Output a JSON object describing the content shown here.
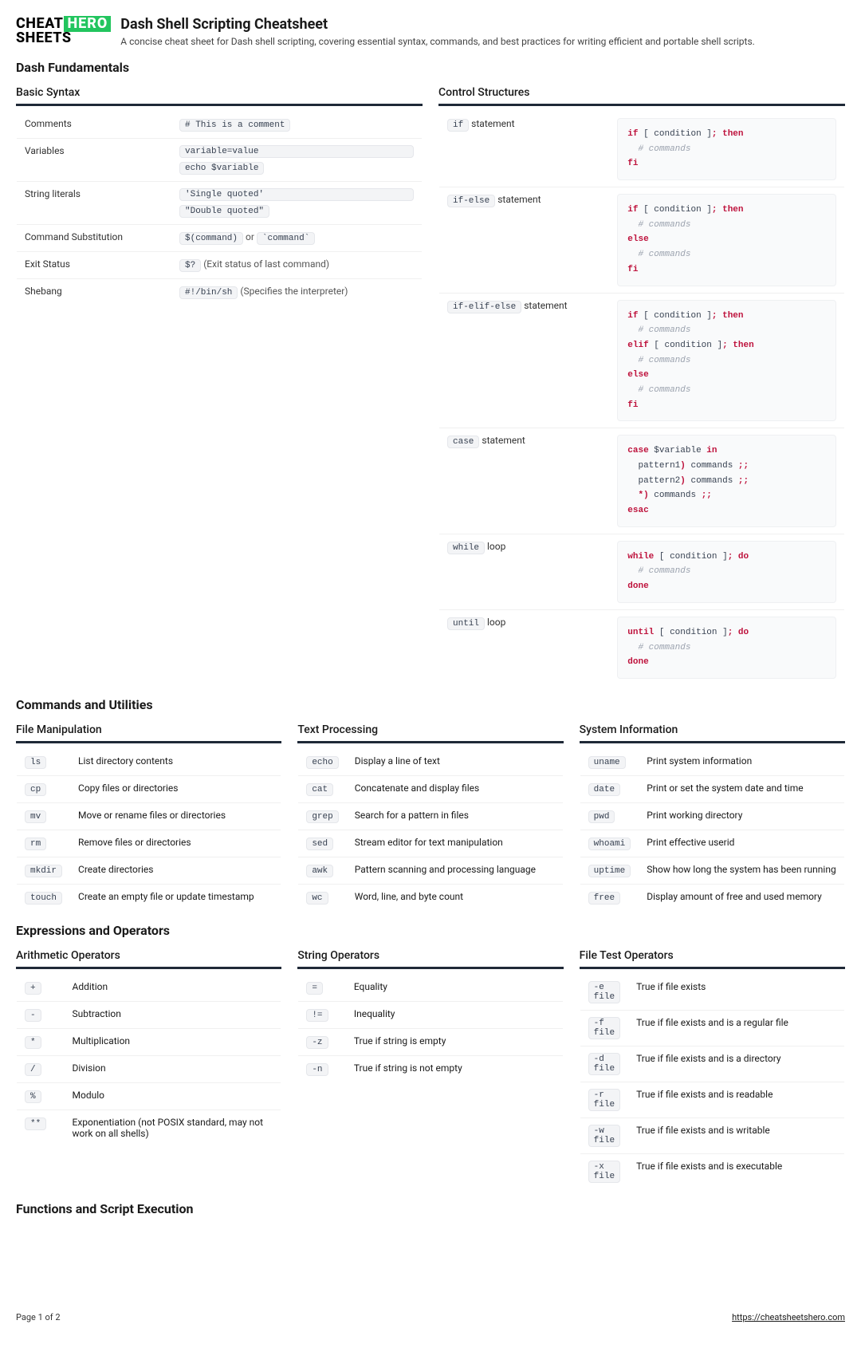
{
  "header": {
    "logo_top_left": "CHEAT",
    "logo_top_right": "HERO",
    "logo_bottom": "SHEETS",
    "title": "Dash Shell Scripting Cheatsheet",
    "subtitle": "A concise cheat sheet for Dash shell scripting, covering essential syntax, commands, and best practices for writing efficient and portable shell scripts."
  },
  "sections": {
    "fundamentals": {
      "title": "Dash Fundamentals",
      "basic_syntax": {
        "title": "Basic Syntax",
        "rows": [
          {
            "label": "Comments",
            "code": "# This is a comment"
          },
          {
            "label": "Variables",
            "code1": "variable=value",
            "code2": "echo $variable"
          },
          {
            "label": "String literals",
            "code1": "'Single quoted'",
            "code2": "\"Double quoted\""
          },
          {
            "label": "Command Substitution",
            "code": "$(command)",
            "note": " or ",
            "code2b": "`command`"
          },
          {
            "label": "Exit Status",
            "code": "$?",
            "note": " (Exit status of last command)"
          },
          {
            "label": "Shebang",
            "code": "#!/bin/sh",
            "note": " (Specifies the interpreter)"
          }
        ]
      },
      "control": {
        "title": "Control Structures",
        "rows": [
          {
            "label_code": "if",
            "label_text": " statement"
          },
          {
            "label_code": "if-else",
            "label_text": " statement"
          },
          {
            "label_code": "if-elif-else",
            "label_text": " statement"
          },
          {
            "label_code": "case",
            "label_text": " statement"
          },
          {
            "label_code": "while",
            "label_text": " loop"
          },
          {
            "label_code": "until",
            "label_text": " loop"
          }
        ]
      }
    },
    "commands": {
      "title": "Commands and Utilities",
      "file": {
        "title": "File Manipulation",
        "rows": [
          {
            "cmd": "ls",
            "desc": "List directory contents"
          },
          {
            "cmd": "cp",
            "desc": "Copy files or directories"
          },
          {
            "cmd": "mv",
            "desc": "Move or rename files or directories"
          },
          {
            "cmd": "rm",
            "desc": "Remove files or directories"
          },
          {
            "cmd": "mkdir",
            "desc": "Create directories"
          },
          {
            "cmd": "touch",
            "desc": "Create an empty file or update timestamp"
          }
        ]
      },
      "text": {
        "title": "Text Processing",
        "rows": [
          {
            "cmd": "echo",
            "desc": "Display a line of text"
          },
          {
            "cmd": "cat",
            "desc": "Concatenate and display files"
          },
          {
            "cmd": "grep",
            "desc": "Search for a pattern in files"
          },
          {
            "cmd": "sed",
            "desc": "Stream editor for text manipulation"
          },
          {
            "cmd": "awk",
            "desc": "Pattern scanning and processing language"
          },
          {
            "cmd": "wc",
            "desc": "Word, line, and byte count"
          }
        ]
      },
      "system": {
        "title": "System Information",
        "rows": [
          {
            "cmd": "uname",
            "desc": "Print system information"
          },
          {
            "cmd": "date",
            "desc": "Print or set the system date and time"
          },
          {
            "cmd": "pwd",
            "desc": "Print working directory"
          },
          {
            "cmd": "whoami",
            "desc": "Print effective userid"
          },
          {
            "cmd": "uptime",
            "desc": "Show how long the system has been running"
          },
          {
            "cmd": "free",
            "desc": "Display amount of free and used memory"
          }
        ]
      }
    },
    "expressions": {
      "title": "Expressions and Operators",
      "arithmetic": {
        "title": "Arithmetic Operators",
        "rows": [
          {
            "op": "+",
            "desc": "Addition"
          },
          {
            "op": "-",
            "desc": "Subtraction"
          },
          {
            "op": "*",
            "desc": "Multiplication"
          },
          {
            "op": "/",
            "desc": "Division"
          },
          {
            "op": "%",
            "desc": "Modulo"
          },
          {
            "op": "**",
            "desc": "Exponentiation (not POSIX standard, may not work on all shells)"
          }
        ]
      },
      "string": {
        "title": "String Operators",
        "rows": [
          {
            "op": "=",
            "desc": "Equality"
          },
          {
            "op": "!=",
            "desc": "Inequality"
          },
          {
            "op": "-z",
            "desc": "True if string is empty"
          },
          {
            "op": "-n",
            "desc": "True if string is not empty"
          }
        ]
      },
      "filetest": {
        "title": "File Test Operators",
        "rows": [
          {
            "op": "-e file",
            "desc": "True if file exists"
          },
          {
            "op": "-f file",
            "desc": "True if file exists and is a regular file"
          },
          {
            "op": "-d file",
            "desc": "True if file exists and is a directory"
          },
          {
            "op": "-r file",
            "desc": "True if file exists and is readable"
          },
          {
            "op": "-w file",
            "desc": "True if file exists and is writable"
          },
          {
            "op": "-x file",
            "desc": "True if file exists and is executable"
          }
        ]
      }
    },
    "functions": {
      "title": "Functions and Script Execution"
    }
  },
  "footer": {
    "page": "Page 1 of 2",
    "url": "https://cheatsheetshero.com"
  }
}
